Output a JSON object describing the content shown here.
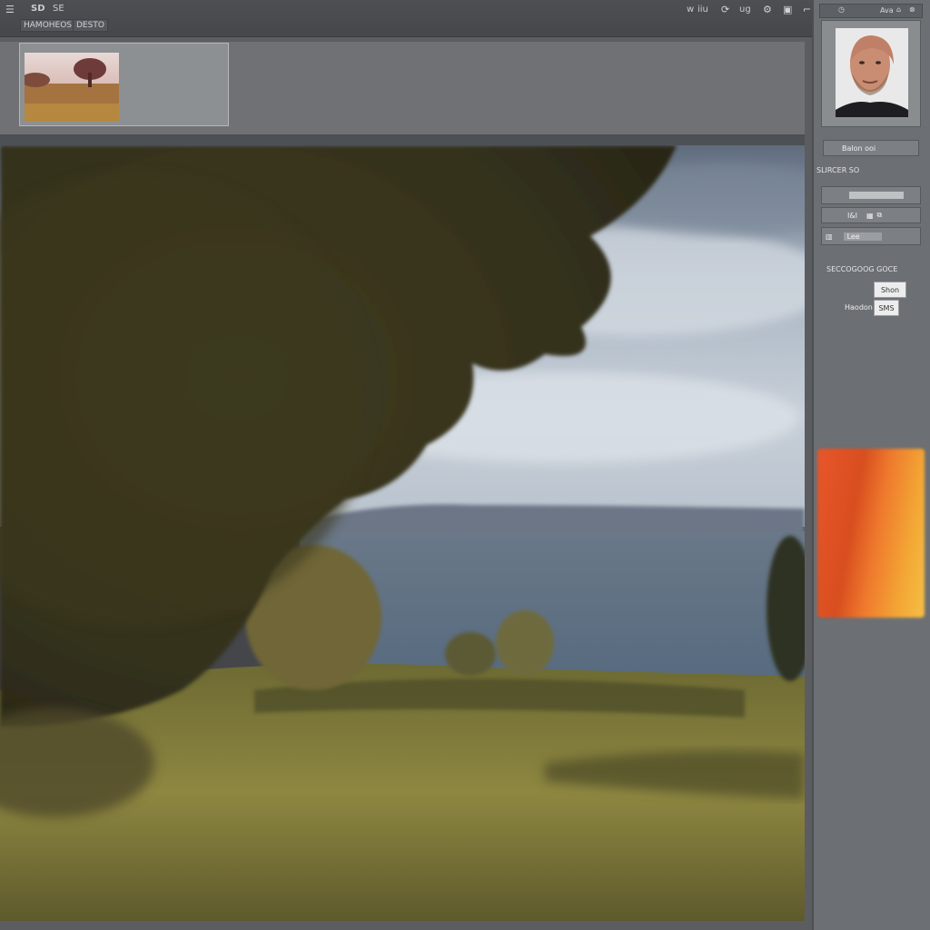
{
  "toolbar": {
    "left_items": [
      "SD",
      "SE"
    ],
    "tabs": [
      "HAMOHEOS",
      "DESTO"
    ],
    "right_items": [
      "w",
      "iiu",
      "G",
      "ug"
    ],
    "side_top_text": "Ava"
  },
  "sidebar": {
    "button_1": "Balon ooi",
    "section_label": "SLIRCER SO",
    "row_value": "I&I",
    "row_2": "Lee",
    "section_label_2": "SECCOGOOG GOCE",
    "field_1": "Shon",
    "field_2_label": "Haodon",
    "field_2": "SMS"
  },
  "colors": {
    "swatch_start": "#e8562a",
    "swatch_end": "#f6bf45",
    "accent": "#ea6b2a"
  },
  "icons": {
    "menu": "menu-icon",
    "search": "search-icon",
    "settings": "gear-icon",
    "image": "image-icon",
    "close": "close-icon"
  }
}
